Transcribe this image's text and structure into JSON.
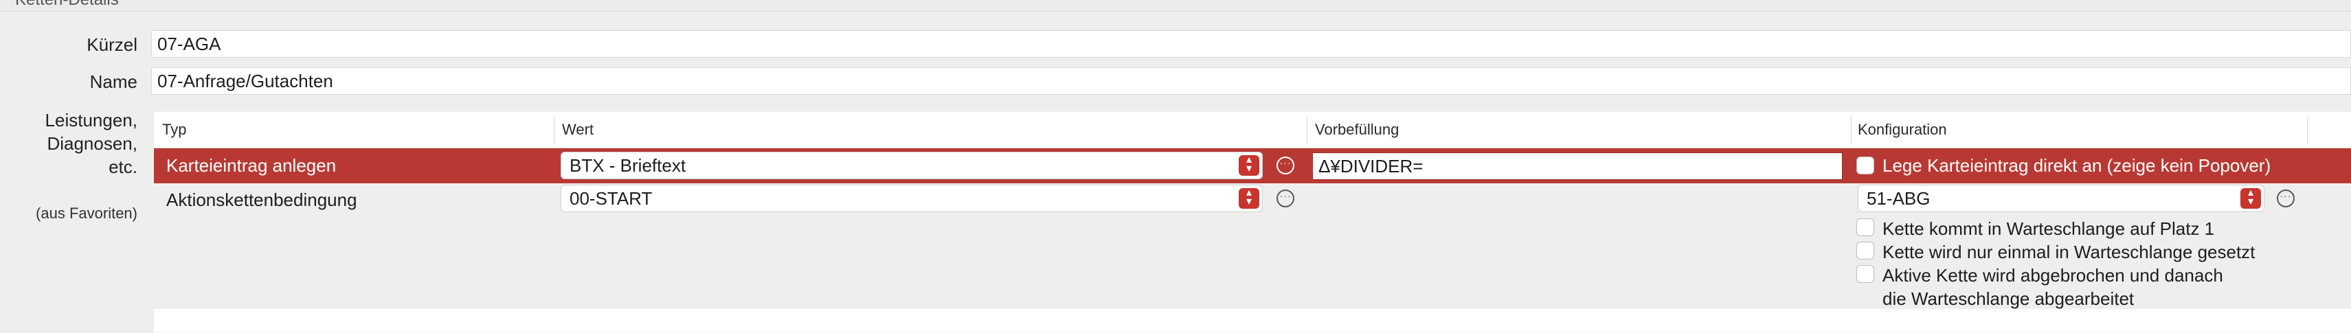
{
  "section": {
    "title": "Ketten-Details"
  },
  "form": {
    "kuerzel_label": "Kürzel",
    "kuerzel_value": "07-AGA",
    "name_label": "Name",
    "name_value": "07-Anfrage/Gutachten",
    "leistungen_label_1": "Leistungen,",
    "leistungen_label_2": "Diagnosen,",
    "leistungen_label_3": "etc.",
    "favorites_label": "(aus Favoriten)"
  },
  "table": {
    "headers": {
      "typ": "Typ",
      "wert": "Wert",
      "vorbefuellung": "Vorbefüllung",
      "konfiguration": "Konfiguration"
    },
    "rows": [
      {
        "typ": "Karteieintrag anlegen",
        "wert": "BTX - Brieftext",
        "vorbefuellung": "Δ¥DIVIDER=",
        "konfiguration_checkbox": "Lege Karteieintrag direkt an (zeige kein Popover)"
      },
      {
        "typ": "Aktionskettenbedingung",
        "wert": "00-START",
        "konfiguration_select": "51-ABG",
        "option_1": "Kette kommt in Warteschlange auf Platz 1",
        "option_2": "Kette wird nur einmal in Warteschlange gesetzt",
        "option_3_line1": "Aktive Kette wird abgebrochen und danach",
        "option_3_line2": "die Warteschlange abgearbeitet"
      }
    ]
  },
  "colors": {
    "selection": "#b83933",
    "accent": "#c8342e"
  }
}
